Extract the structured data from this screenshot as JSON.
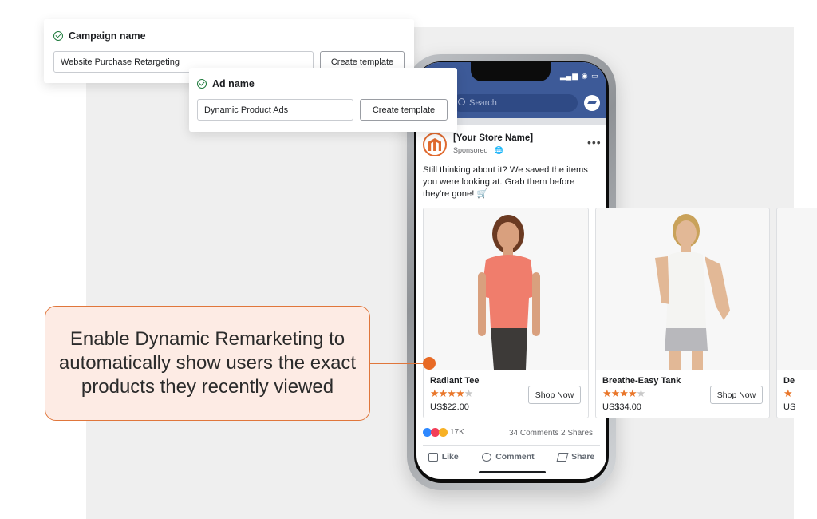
{
  "campaign": {
    "title": "Campaign name",
    "value": "Website Purchase Retargeting",
    "button": "Create template"
  },
  "ad": {
    "title": "Ad name",
    "value": "Dynamic Product Ads",
    "button": "Create template"
  },
  "phone": {
    "search_placeholder": "Search",
    "store_name": "[Your Store Name]",
    "sponsored": "Sponsored · 🌐",
    "post_text": "Still thinking about it? We saved the items you were looking at. Grab them before they're gone! 🛒",
    "products": [
      {
        "name": "Radiant Tee",
        "stars": "★★★★",
        "half": "★",
        "price": "US$22.00",
        "cta": "Shop Now"
      },
      {
        "name": "Breathe-Easy Tank",
        "stars": "★★★★",
        "half": "★",
        "price": "US$34.00",
        "cta": "Shop Now"
      },
      {
        "name": "De",
        "stars": "★",
        "half": "",
        "price": "US",
        "cta": ""
      }
    ],
    "reactions_count": "17K",
    "comments": "34 Comments",
    "shares": "2 Shares",
    "actions": {
      "like": "Like",
      "comment": "Comment",
      "share": "Share"
    }
  },
  "callout": {
    "text": "Enable Dynamic Remarketing to automatically show users the exact products they recently viewed"
  },
  "colors": {
    "accent": "#e86a25",
    "callout_bg": "#fdebe4",
    "fb_blue": "#3d5a98",
    "check_green": "#1e7a3c"
  }
}
